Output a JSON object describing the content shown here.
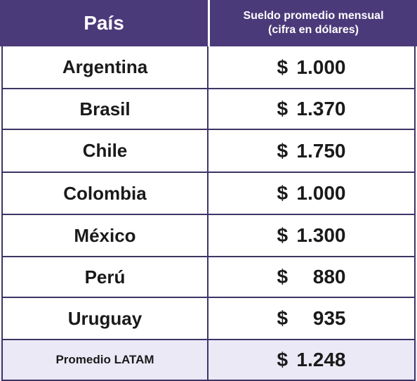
{
  "header": {
    "country_label": "País",
    "salary_label_line1": "Sueldo promedio mensual",
    "salary_label_line2": "(cifra en dólares)"
  },
  "rows": [
    {
      "country": "Argentina",
      "currency": "$",
      "amount": "1.000"
    },
    {
      "country": "Brasil",
      "currency": "$",
      "amount": "1.370"
    },
    {
      "country": "Chile",
      "currency": "$",
      "amount": "1.750"
    },
    {
      "country": "Colombia",
      "currency": "$",
      "amount": "1.000"
    },
    {
      "country": "México",
      "currency": "$",
      "amount": "1.300"
    },
    {
      "country": "Perú",
      "currency": "$",
      "amount": "880"
    },
    {
      "country": "Uruguay",
      "currency": "$",
      "amount": "935"
    }
  ],
  "total": {
    "label": "Promedio LATAM",
    "currency": "$",
    "amount": "1.248"
  },
  "colors": {
    "header_bg": "#4b3a7a",
    "total_bg": "#ece9f7",
    "border": "#3f3466"
  }
}
